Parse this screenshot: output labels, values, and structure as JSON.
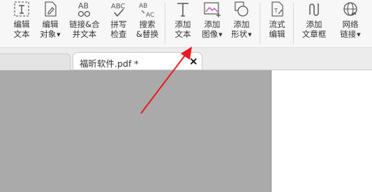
{
  "toolbar": {
    "tools": [
      {
        "icon": "edit-text-icon",
        "line1": "编辑",
        "line2": "文本",
        "dropdown": false
      },
      {
        "icon": "edit-object-icon",
        "line1": "编辑",
        "line2": "对象",
        "dropdown": true
      },
      {
        "icon": "link-merge-icon",
        "line1": "链接&合",
        "line2": "并文本",
        "dropdown": false
      },
      {
        "icon": "spell-check-icon",
        "line1": "拼写",
        "line2": "检查",
        "dropdown": false
      },
      {
        "icon": "search-replace-icon",
        "line1": "搜索",
        "line2": "&替换",
        "dropdown": false
      },
      {
        "icon": "add-text-icon",
        "line1": "添加",
        "line2": "文本",
        "dropdown": false
      },
      {
        "icon": "add-image-icon",
        "line1": "添加",
        "line2": "图像",
        "dropdown": true
      },
      {
        "icon": "add-shape-icon",
        "line1": "添加",
        "line2": "形状",
        "dropdown": true
      },
      {
        "icon": "flow-edit-icon",
        "line1": "流式",
        "line2": "编辑",
        "dropdown": false
      },
      {
        "icon": "add-textbox-icon",
        "line1": "添加",
        "line2": "文章框",
        "dropdown": false
      },
      {
        "icon": "web-link-icon",
        "line1": "网络",
        "line2": "链接",
        "dropdown": true
      }
    ]
  },
  "tabs": {
    "active": {
      "title": "福昕软件.pdf *",
      "close_glyph": "×"
    }
  },
  "colors": {
    "annotation_arrow": "#e8191f",
    "document_background": "#aaaaaa",
    "ribbon_background": "#f7f7f7"
  }
}
